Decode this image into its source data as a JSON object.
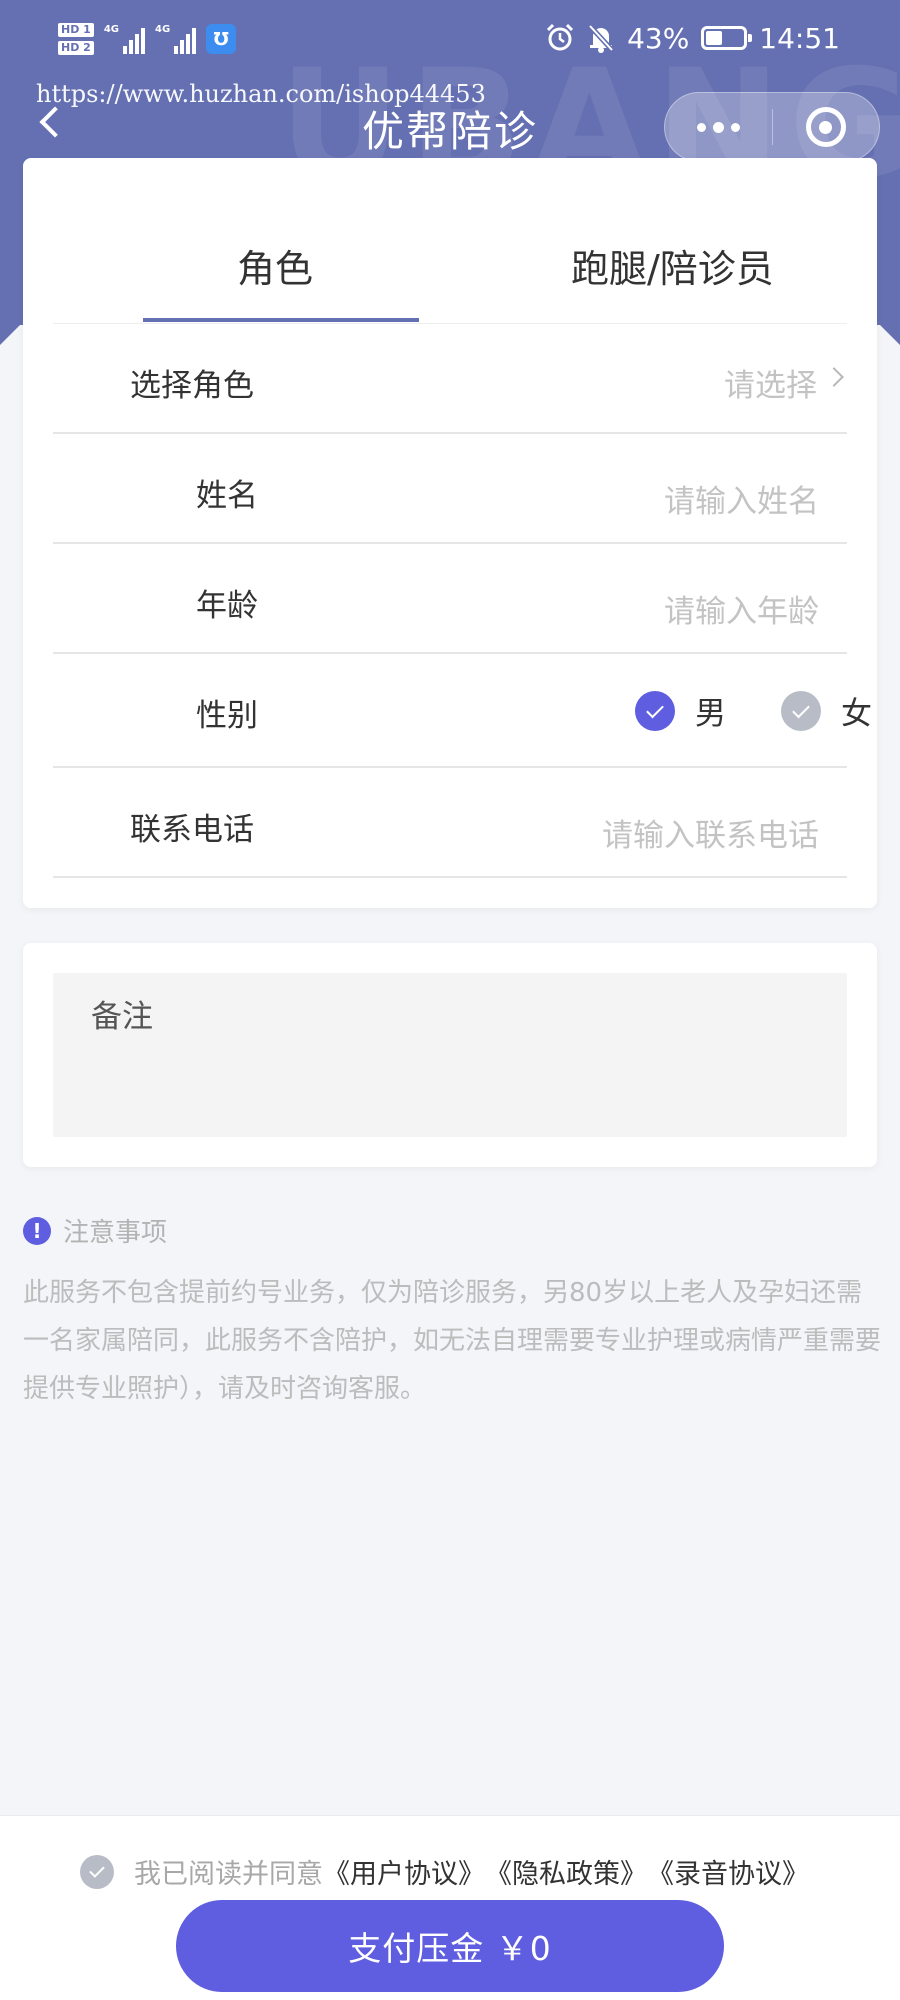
{
  "status_bar": {
    "hd1": "HD 1",
    "hd2": "HD 2",
    "net1": "4G",
    "net2": "4G",
    "app_badge": "Ʊ",
    "battery": "43%",
    "battery_level": 0.43,
    "time": "14:51"
  },
  "nav": {
    "title": "优帮陪诊",
    "watermark_url": "https://www.huzhan.com/ishop44453",
    "hero_watermark": "UBANG"
  },
  "tabs": [
    {
      "label": "角色"
    },
    {
      "label": "跑腿/陪诊员"
    }
  ],
  "form": {
    "role_label": "选择角色",
    "role_placeholder": "请选择",
    "name_label": "姓名",
    "name_placeholder": "请输入姓名",
    "age_label": "年龄",
    "age_placeholder": "请输入年龄",
    "gender_label": "性别",
    "gender_male": "男",
    "gender_female": "女",
    "phone_label": "联系电话",
    "phone_placeholder": "请输入联系电话"
  },
  "remark": {
    "label": "备注"
  },
  "notice": {
    "icon": "!",
    "title": "注意事项",
    "text": "此服务不包含提前约号业务，仅为陪诊服务，另80岁以上老人及孕妇还需一名家属陪同，此服务不含陪护，如无法自理需要专业护理或病情严重需要提供专业照护），请及时咨询客服。"
  },
  "agreement": {
    "prefix": "我已阅读并同意",
    "link1": "《用户协议》",
    "link2": "《隐私政策》",
    "link3": "《录音协议》"
  },
  "pay_button": "支付压金 ￥0",
  "colors": {
    "header_bg": "#6570b2",
    "accent": "#5f5de0",
    "page_bg": "#f4f5f8"
  }
}
